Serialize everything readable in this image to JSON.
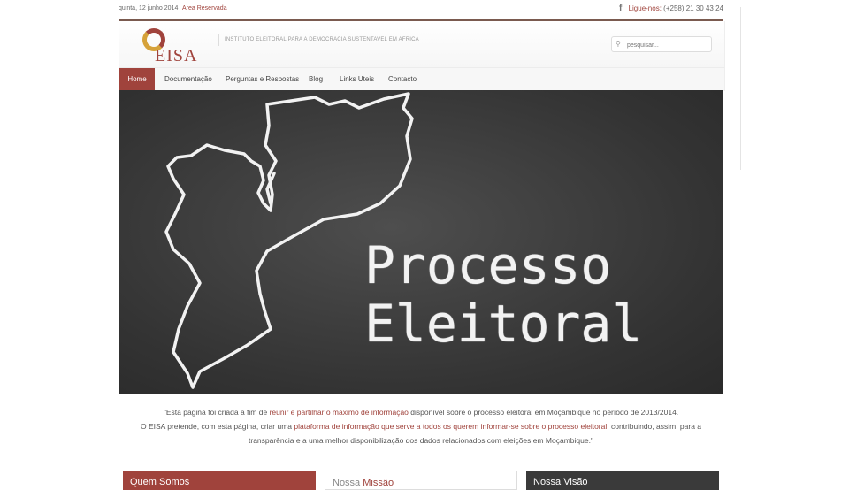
{
  "topbar": {
    "date": "quinta, 12 junho 2014",
    "restricted_area": "Area Reservada",
    "facebook_icon": "facebook-icon",
    "phone_label": "Ligue-nos:",
    "phone_number": "(+258) 21 30 43 24"
  },
  "header": {
    "logo_text": "EISA",
    "tagline": "INSTITUTO ELEITORAL PARA A DEMOCRACIA SUSTENTAVEL EM AFRICA",
    "search_placeholder": "pesquisar..."
  },
  "nav": {
    "items": [
      {
        "label": "Home"
      },
      {
        "label": "Documentação"
      },
      {
        "label": "Perguntas e Respostas"
      },
      {
        "label": "Blog"
      },
      {
        "label": "Links Uteis"
      },
      {
        "label": "Contacto"
      }
    ]
  },
  "hero": {
    "line1": "Processo",
    "line2": "Eleitoral"
  },
  "intro": {
    "p1_a": "\"Esta página foi criada a fim de ",
    "p1_link": "reunir e partilhar o máximo de informação",
    "p1_b": " disponível sobre o processo eleitoral em Moçambique no período de 2013/2014.",
    "p2_a": "O EISA pretende, com esta página, criar uma ",
    "p2_link": "plataforma de informação que serve a todos os querem informar-se sobre o processo eleitoral",
    "p2_b": ", contribuindo, assim, para a",
    "p3": "transparência e a uma melhor disponibilização dos dados relacionados com eleições em Moçambique.\""
  },
  "boxes": {
    "who_label": "Quem Somos",
    "mission_prefix": "Nossa ",
    "mission_word": "Missão",
    "vision_label": "Nossa Visão"
  },
  "colors": {
    "accent": "#a0433c",
    "dark": "#3a3a3a"
  }
}
